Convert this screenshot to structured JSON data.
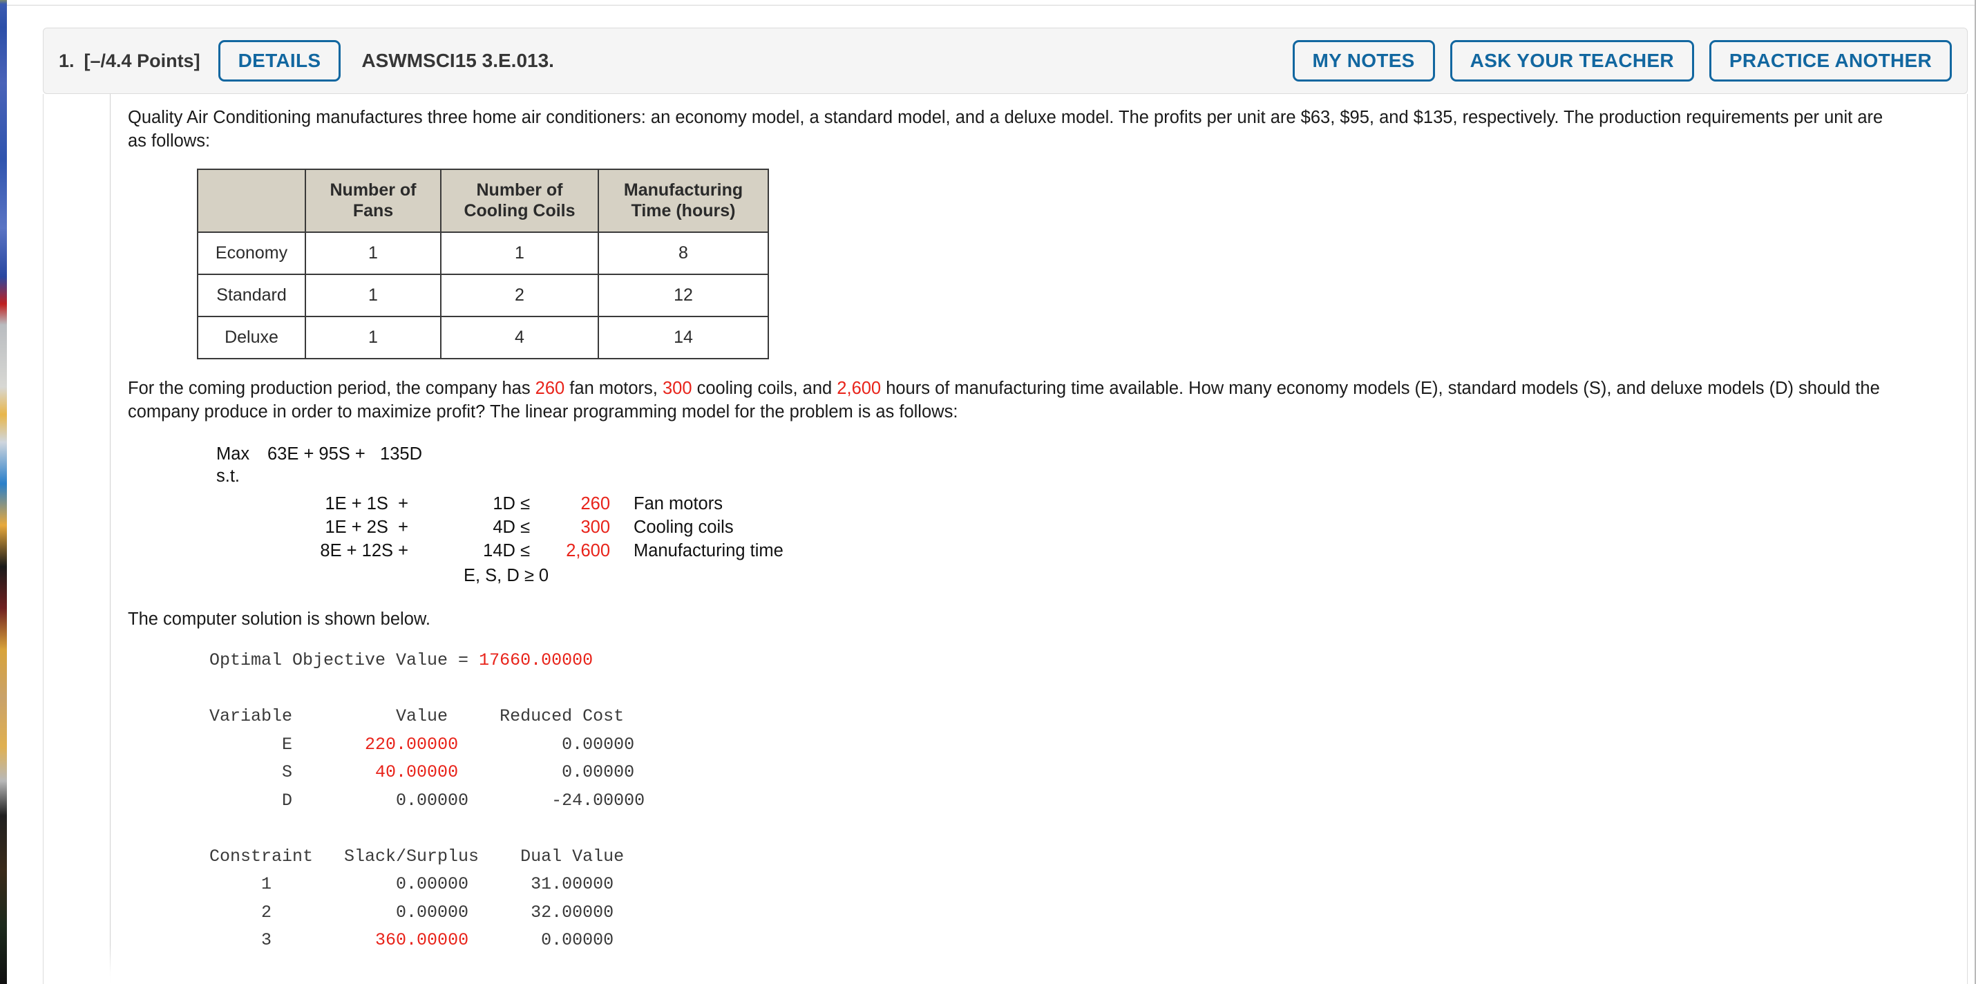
{
  "header": {
    "question_number": "1.",
    "points": "[–/4.4 Points]",
    "details_label": "DETAILS",
    "problem_id": "ASWMSCI15 3.E.013.",
    "my_notes_label": "MY NOTES",
    "ask_teacher_label": "ASK YOUR TEACHER",
    "practice_another_label": "PRACTICE ANOTHER",
    "accent_color": "#1267a0",
    "card_bg": "#f5f5f5"
  },
  "problem": {
    "intro_part1": "Quality Air Conditioning manufactures three home air conditioners: an economy model, a standard model, and a deluxe model. The profits per unit are ",
    "profit_economy": "$63",
    "profit_standard": "$95",
    "profit_deluxe": "$135",
    "intro_part2": ", respectively. The production requirements per unit are as follows:",
    "table": {
      "corner_label": "",
      "columns": [
        "Number of\nFans",
        "Number of\nCooling Coils",
        "Manufacturing\nTime (hours)"
      ],
      "col_fans_line1": "Number of",
      "col_fans_line2": "Fans",
      "col_coils_line1": "Number of",
      "col_coils_line2": "Cooling Coils",
      "col_time_line1": "Manufacturing",
      "col_time_line2": "Time (hours)",
      "rows": [
        {
          "label": "Economy",
          "fans": "1",
          "coils": "1",
          "time": "8"
        },
        {
          "label": "Standard",
          "fans": "1",
          "coils": "2",
          "time": "12"
        },
        {
          "label": "Deluxe",
          "fans": "1",
          "coils": "4",
          "time": "14"
        }
      ]
    },
    "resources_lead": "For the coming production period, the company has ",
    "fan_motors": "260",
    "fan_motors_tail": " fan motors, ",
    "cooling_coils": "300",
    "cooling_coils_tail": " cooling coils, and ",
    "manufacturing_hours": "2,600",
    "resources_tail": " hours of manufacturing time available. How many economy models (E), standard models (S), and deluxe models (D) should the company produce in order to maximize profit? The linear programming model for the problem is as follows:",
    "solution_lead": "The computer solution is shown below."
  },
  "lp_model": {
    "max_label": "Max",
    "objective": "63E + 95S +   135D",
    "obj_e": "63E",
    "obj_s": "95S",
    "obj_d": "135D",
    "st_label": "s.t.",
    "constraints": [
      {
        "lhs": "1E + 1S  +",
        "mid": "1D ≤",
        "rhs": "260",
        "name": "Fan motors"
      },
      {
        "lhs": "1E + 2S  +",
        "mid": "4D ≤",
        "rhs": "300",
        "name": "Cooling coils"
      },
      {
        "lhs": "8E + 12S +",
        "mid": "14D ≤",
        "rhs": "2,600",
        "name": "Manufacturing time"
      }
    ],
    "nonnegativity": "E, S, D ≥ 0"
  },
  "computer_output": {
    "objective_label": "Optimal Objective Value = ",
    "objective_value": "17660.00000",
    "variable_header": "Variable          Value     Reduced Cost",
    "variables": [
      {
        "line_pre": "       E       ",
        "value": "220.00000",
        "line_post": "          0.00000"
      },
      {
        "line_pre": "       S        ",
        "value": "40.00000",
        "line_post": "          0.00000"
      },
      {
        "line_post_only": "       D          0.00000        -24.00000"
      }
    ],
    "constraint_header": "Constraint   Slack/Surplus    Dual Value",
    "constraints": [
      {
        "line": "     1            0.00000      31.00000"
      },
      {
        "line": "     2            0.00000      32.00000"
      },
      {
        "line_pre": "     3          ",
        "value": "360.00000",
        "line_post": "       0.00000"
      }
    ]
  },
  "colors": {
    "red": "#e8231a",
    "table_header_bg": "#d6d1c4",
    "text": "#1a1a1a"
  }
}
